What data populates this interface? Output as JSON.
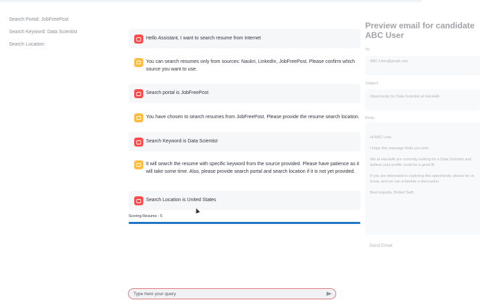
{
  "sidebar": {
    "portal": "Search Portal: JobFreePost",
    "keyword": "Search Keyword: Data Scientist",
    "location": "Search Location:"
  },
  "messages": [
    {
      "role": "user",
      "text": "Hello Assistant, I want to search resume from Internet"
    },
    {
      "role": "bot",
      "text": "You can search resumes only from sources: Naukri, LinkedIn, JobFreePost. Please confirm which source you want to use."
    },
    {
      "role": "user",
      "text": "Search portal is JobFreePost"
    },
    {
      "role": "bot",
      "text": "You have chosen to search resumes from JobFreePost. Please provide the resume search location."
    },
    {
      "role": "user",
      "text": "Search Keyword is Data Scientist"
    },
    {
      "role": "bot",
      "text": "It will search the resume with specific keyword from the source provided. Please have patience as it will take some time. Also, please provide search portal and search location if it is not yet provided."
    },
    {
      "role": "user",
      "text": "Search Location is United States"
    }
  ],
  "progress": {
    "label": "Scoring Resume - 5",
    "value": 1.0,
    "color": "#1f77c4"
  },
  "query": {
    "placeholder": "Type here your query"
  },
  "email_panel": {
    "title": "Preview email for candidate ABC User",
    "to_label": "To:",
    "to_value": "ABC User@gmail.com",
    "subject_label": "Subject:",
    "subject_value": "Opportunity for Data Scientist at HarvikAI",
    "body_label": "Body:",
    "body_lines": [
      "Hi ABC User,",
      "I hope this message finds you well.",
      "We at HarvikAI are currently looking for a Data Scientist and believe your profile could be a good fit.",
      "If you are interested in exploring this opportunity, please let us know, and we can schedule a discussion.",
      "Best regards, Bobert Seth"
    ],
    "send_label": "Send Email"
  },
  "colors": {
    "user_avatar": "#ff4b4b",
    "bot_avatar": "#ffbd45",
    "input_border": "#e07a7a"
  }
}
